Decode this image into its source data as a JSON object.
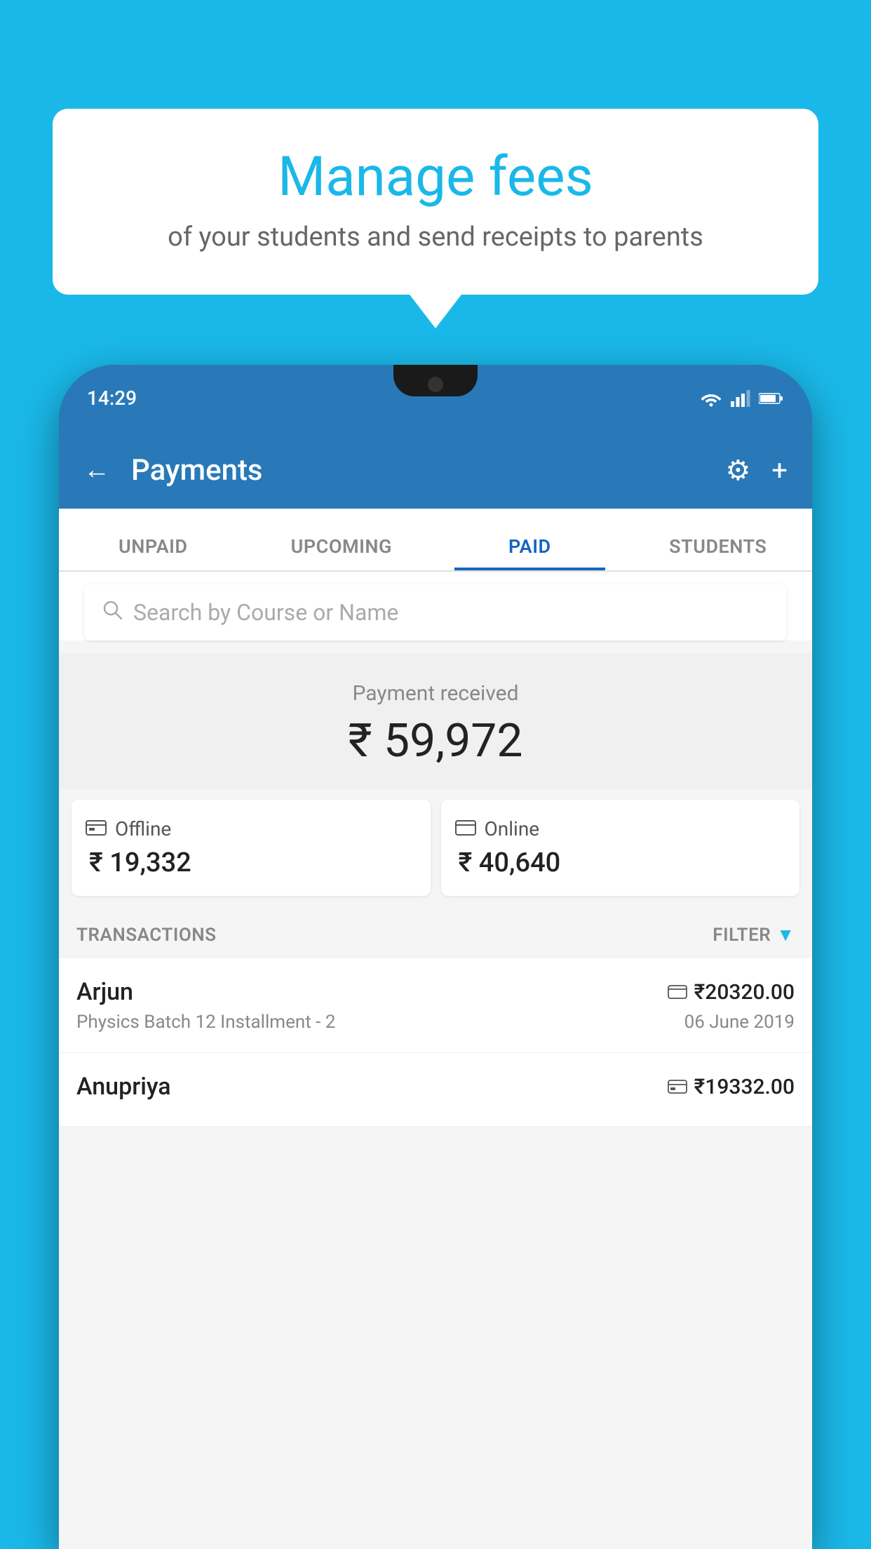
{
  "background_color": "#1ab8e8",
  "bubble": {
    "title": "Manage fees",
    "subtitle": "of your students and send receipts to parents"
  },
  "status_bar": {
    "time": "14:29",
    "wifi": "wifi",
    "signal": "signal",
    "battery": "battery"
  },
  "app_bar": {
    "title": "Payments",
    "back_label": "←",
    "gear_label": "⚙",
    "plus_label": "+"
  },
  "tabs": [
    {
      "label": "UNPAID",
      "active": false
    },
    {
      "label": "UPCOMING",
      "active": false
    },
    {
      "label": "PAID",
      "active": true
    },
    {
      "label": "STUDENTS",
      "active": false
    }
  ],
  "search": {
    "placeholder": "Search by Course or Name",
    "icon": "search"
  },
  "payment_received": {
    "label": "Payment received",
    "amount": "₹ 59,972"
  },
  "cards": [
    {
      "label": "Offline",
      "amount": "₹ 19,332",
      "icon": "offline-payment"
    },
    {
      "label": "Online",
      "amount": "₹ 40,640",
      "icon": "online-payment"
    }
  ],
  "transactions_section": {
    "label": "TRANSACTIONS",
    "filter_label": "FILTER",
    "filter_icon": "filter"
  },
  "transactions": [
    {
      "name": "Arjun",
      "course": "Physics Batch 12 Installment - 2",
      "amount": "₹20320.00",
      "date": "06 June 2019",
      "payment_type": "online"
    },
    {
      "name": "Anupriya",
      "course": "",
      "amount": "₹19332.00",
      "date": "",
      "payment_type": "offline"
    }
  ]
}
